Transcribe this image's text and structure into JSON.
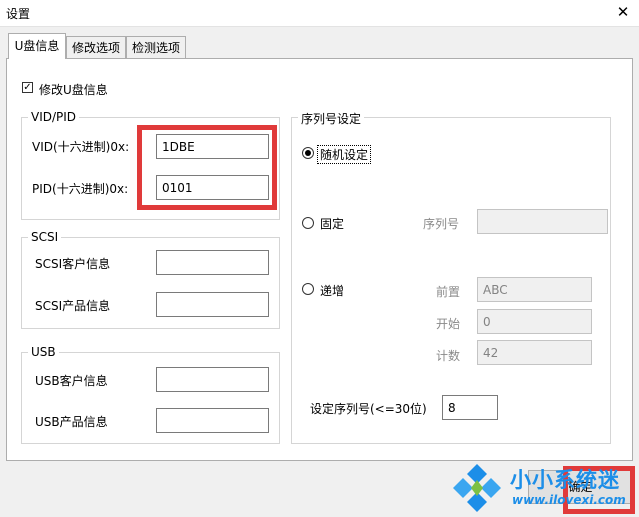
{
  "window": {
    "title": "设置",
    "close_glyph": "✕"
  },
  "tabs": [
    {
      "label": "U盘信息",
      "active": true
    },
    {
      "label": "修改选项",
      "active": false
    },
    {
      "label": "检测选项",
      "active": false
    }
  ],
  "modify_checkbox": {
    "label": "修改U盘信息",
    "checked": true,
    "mark": "✓"
  },
  "vidpid": {
    "title": "VID/PID",
    "vid_label": "VID(十六进制)0x:",
    "vid_value": "1DBE",
    "pid_label": "PID(十六进制)0x:",
    "pid_value": "0101"
  },
  "scsi": {
    "title": "SCSI",
    "vendor_label": "SCSI客户信息",
    "vendor_value": "",
    "product_label": "SCSI产品信息",
    "product_value": ""
  },
  "usb": {
    "title": "USB",
    "vendor_label": "USB客户信息",
    "vendor_value": "",
    "product_label": "USB产品信息",
    "product_value": ""
  },
  "serial": {
    "title": "序列号设定",
    "random_label": "随机设定",
    "fixed_label": "固定",
    "serial_label": "序列号",
    "serial_value": "",
    "increment_label": "递增",
    "prefix_label": "前置",
    "prefix_value": "ABC",
    "start_label": "开始",
    "start_value": "0",
    "count_label": "计数",
    "count_value": "42",
    "length_label": "设定序列号(<=30位)",
    "length_value": "8",
    "selected": "random"
  },
  "ok_button": {
    "label": "确定"
  },
  "watermark": {
    "title": "小小系统迷",
    "url": "www.ilovexi.com"
  },
  "colors": {
    "highlight": "#e03a3a",
    "watermark": "#1c8ee8"
  }
}
